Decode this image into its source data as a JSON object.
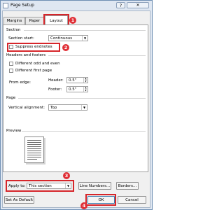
{
  "window": {
    "title": "Page Setup",
    "help_glyph": "?",
    "close_glyph": "✕"
  },
  "tabs": [
    {
      "label": "Margins"
    },
    {
      "label": "Paper"
    },
    {
      "label": "Layout",
      "selected": true
    }
  ],
  "section": {
    "heading": "Section",
    "start_label": "Section start:",
    "start_value": "Continuous",
    "suppress_endnotes": {
      "label": "Suppress endnotes",
      "checked": false
    }
  },
  "headers_footers": {
    "heading": "Headers and footers",
    "odd_even": {
      "label": "Different odd and even",
      "checked": false
    },
    "first_page": {
      "label": "Different first page",
      "checked": false
    },
    "from_edge_label": "From edge:",
    "header_label": "Header:",
    "header_value": "0.5\"",
    "footer_label": "Footer:",
    "footer_value": "0.5\""
  },
  "page": {
    "heading": "Page",
    "vertical_alignment_label": "Vertical alignment:",
    "vertical_alignment_value": "Top"
  },
  "preview": {
    "heading": "Preview"
  },
  "apply_to": {
    "label": "Apply to:",
    "value": "This section"
  },
  "buttons": {
    "line_numbers": "Line Numbers...",
    "borders": "Borders...",
    "set_default": "Set As Default",
    "ok": "OK",
    "cancel": "Cancel"
  },
  "annotations": {
    "callouts": [
      "1",
      "2",
      "3",
      "4"
    ],
    "color": "#d6262b"
  }
}
